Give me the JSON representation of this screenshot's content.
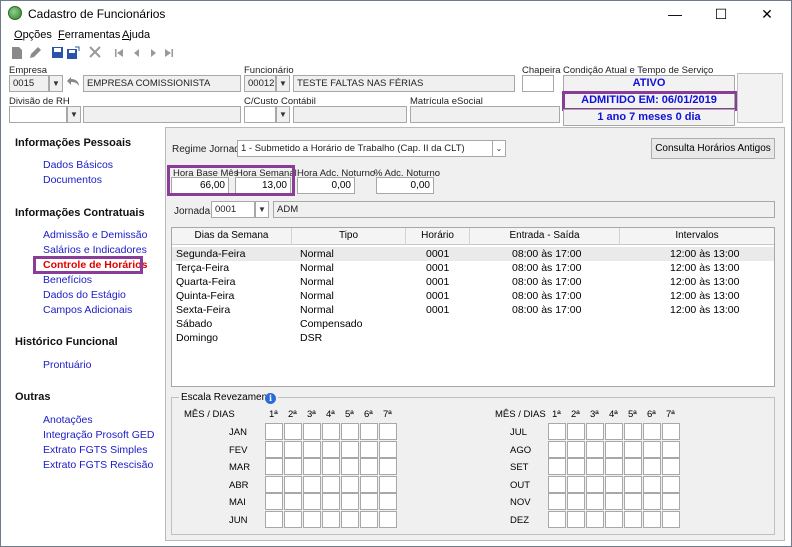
{
  "window": {
    "title": "Cadastro de Funcionários"
  },
  "menu": {
    "items": [
      "Opções",
      "Ferramentas",
      "Ajuda"
    ]
  },
  "empresa": {
    "label": "Empresa",
    "code": "0015",
    "name": "EMPRESA COMISSIONISTA"
  },
  "funcionario": {
    "label": "Funcionário",
    "code": "00012",
    "name": "TESTE FALTAS NAS FÉRIAS"
  },
  "chapeira": {
    "label": "Chapeira",
    "value": ""
  },
  "condicao": {
    "label": "Condição Atual e Tempo de Serviço",
    "status": "ATIVO",
    "admitido": "ADMITIDO EM: 06/01/2019",
    "tempo": "1 ano 7 meses 0 dia"
  },
  "divisao": {
    "label": "Divisão de RH",
    "value": ""
  },
  "custo": {
    "label": "C/Custo Contábil",
    "value": ""
  },
  "matricula": {
    "label": "Matrícula eSocial",
    "value": ""
  },
  "sidebar": {
    "sections": [
      {
        "title": "Informações Pessoais",
        "items": [
          "Dados Básicos",
          "Documentos"
        ]
      },
      {
        "title": "Informações Contratuais",
        "items": [
          "Admissão e Demissão",
          "Salários e Indicadores",
          "Controle de Horários",
          "Benefícios",
          "Dados do Estágio",
          "Campos Adicionais"
        ]
      },
      {
        "title": "Histórico Funcional",
        "items": [
          "Prontuário"
        ]
      },
      {
        "title": "Outras",
        "items": [
          "Anotações",
          "Integração Prosoft GED",
          "Extrato FGTS Simples",
          "Extrato FGTS Rescisão"
        ]
      }
    ],
    "active": "Controle de Horários"
  },
  "regime": {
    "label": "Regime Jornada",
    "value": "1 - Submetido a Horário de Trabalho (Cap. II da CLT)"
  },
  "consulta_button": "Consulta Horários Antigos",
  "horas": {
    "base_mes_label": "Hora Base Mês",
    "base_mes": "66,00",
    "semanal_label": "Hora Semanal",
    "semanal": "13,00",
    "adc_noturno_label": "Hora Adc. Noturno",
    "adc_noturno": "0,00",
    "pct_adc_label": "% Adc. Noturno",
    "pct_adc": "0,00"
  },
  "jornada": {
    "label": "Jornada:",
    "code": "0001",
    "name": "ADM"
  },
  "grid": {
    "headers": [
      "Dias da Semana",
      "Tipo",
      "Horário",
      "Entrada - Saída",
      "Intervalos"
    ],
    "rows": [
      [
        "Segunda-Feira",
        "Normal",
        "0001",
        "08:00 às 17:00",
        "12:00 às 13:00"
      ],
      [
        "Terça-Feira",
        "Normal",
        "0001",
        "08:00 às 17:00",
        "12:00 às 13:00"
      ],
      [
        "Quarta-Feira",
        "Normal",
        "0001",
        "08:00 às 17:00",
        "12:00 às 13:00"
      ],
      [
        "Quinta-Feira",
        "Normal",
        "0001",
        "08:00 às 17:00",
        "12:00 às 13:00"
      ],
      [
        "Sexta-Feira",
        "Normal",
        "0001",
        "08:00 às 17:00",
        "12:00 às 13:00"
      ],
      [
        "Sábado",
        "Compensado",
        "",
        "",
        ""
      ],
      [
        "Domingo",
        "DSR",
        "",
        "",
        ""
      ]
    ]
  },
  "escala": {
    "title": "Escala Revezamento",
    "mes_dias_label": "MÊS / DIAS",
    "days": [
      "1ª",
      "2ª",
      "3ª",
      "4ª",
      "5ª",
      "6ª",
      "7ª"
    ],
    "months_left": [
      "JAN",
      "FEV",
      "MAR",
      "ABR",
      "MAI",
      "JUN"
    ],
    "months_right": [
      "JUL",
      "AGO",
      "SET",
      "OUT",
      "NOV",
      "DEZ"
    ]
  },
  "icons": [
    "app-icon",
    "minimize-icon",
    "maximize-icon",
    "close-icon",
    "new-doc-icon",
    "edit-icon",
    "save-icon",
    "save-as-icon",
    "delete-icon",
    "first-icon",
    "prev-icon",
    "next-icon",
    "last-icon",
    "info-icon"
  ],
  "colors": {
    "highlight": "#8a3d97",
    "link": "#1a1ac8",
    "active_link": "#e00000",
    "status_text": "#1010d8"
  }
}
